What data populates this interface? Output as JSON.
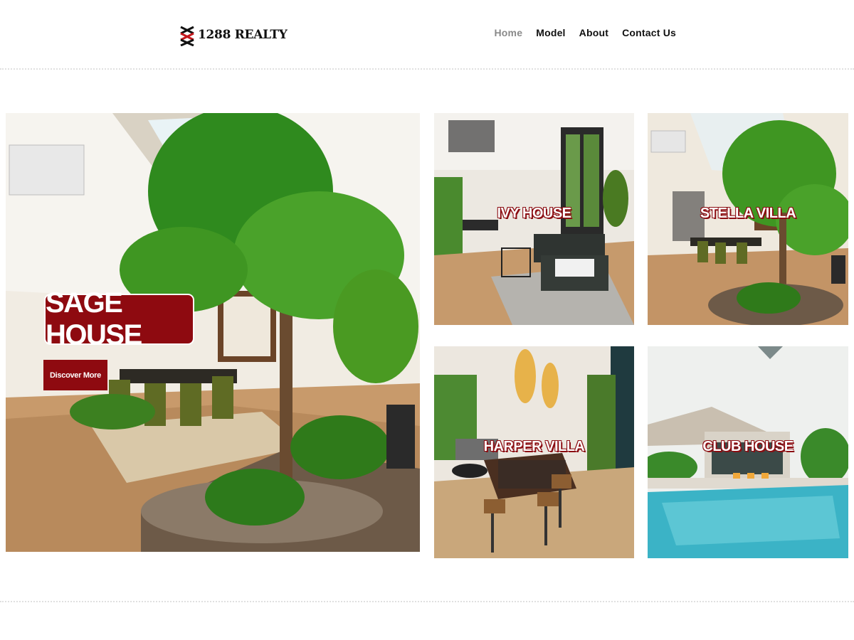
{
  "brand": {
    "name": "1288 REALTY",
    "accent": "#8e0a10"
  },
  "nav": {
    "items": [
      {
        "label": "Home",
        "active": true
      },
      {
        "label": "Model",
        "active": false
      },
      {
        "label": "About",
        "active": false
      },
      {
        "label": "Contact Us",
        "active": false
      }
    ]
  },
  "featured": {
    "title": "SAGE HOUSE",
    "button": "Discover More"
  },
  "models": [
    {
      "title": "IVY HOUSE"
    },
    {
      "title": "STELLA VILLA"
    },
    {
      "title": "HARPER VILLA"
    },
    {
      "title": "CLUB HOUSE"
    }
  ]
}
